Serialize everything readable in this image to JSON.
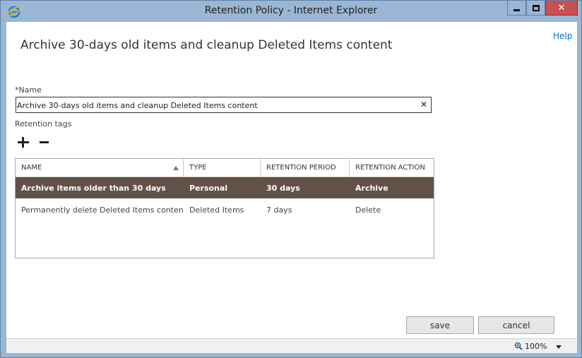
{
  "window": {
    "title": "Retention Policy - Internet Explorer",
    "close_glyph": "✕"
  },
  "header": {
    "help_label": "Help",
    "page_title": "Archive 30-days old items and cleanup Deleted Items content"
  },
  "form": {
    "name_label": "*Name",
    "name_value": "Archive 30-days old items and cleanup Deleted Items content",
    "clear_glyph": "✕",
    "tags_label": "Retention tags"
  },
  "table": {
    "columns": [
      "NAME",
      "TYPE",
      "RETENTION PERIOD",
      "RETENTION ACTION"
    ],
    "rows": [
      {
        "name": "Archive items older than 30 days",
        "type": "Personal",
        "period": "30 days",
        "action": "Archive"
      },
      {
        "name": "Permanently delete Deleted Items content",
        "type": "Deleted Items",
        "period": "7 days",
        "action": "Delete"
      }
    ],
    "selected_row_color": "#625147"
  },
  "actions": {
    "save_label": "save",
    "cancel_label": "cancel"
  },
  "statusbar": {
    "zoom": "100%"
  },
  "icons": {
    "app": "internet-explorer-icon",
    "add": "plus-icon",
    "remove": "minus-icon",
    "zoom": "magnifier-icon"
  },
  "colors": {
    "frame": "#9ab6d4",
    "close_button": "#c75050",
    "link": "#0072c6"
  }
}
